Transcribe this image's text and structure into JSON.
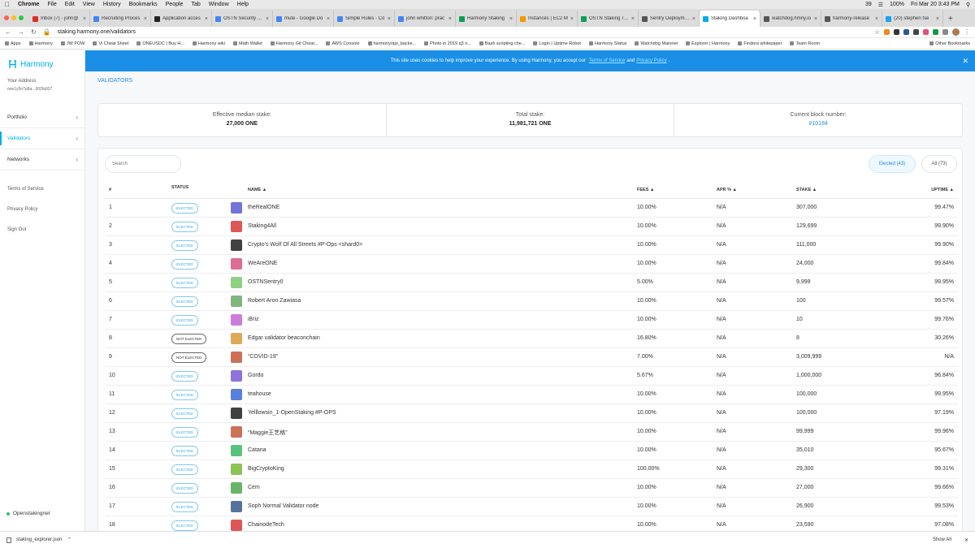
{
  "mac_menu": {
    "items": [
      "Chrome",
      "File",
      "Edit",
      "View",
      "History",
      "Bookmarks",
      "People",
      "Tab",
      "Window",
      "Help"
    ],
    "status": {
      "count": "39",
      "battery": "100%",
      "datetime": "Fri Mar 20  3:43 PM"
    }
  },
  "tabs": [
    {
      "label": "Inbox (7) - john@",
      "color": "#d93025"
    },
    {
      "label": "Recruiting Proces",
      "color": "#4285f4"
    },
    {
      "label": "Application acces",
      "color": "#222222"
    },
    {
      "label": "OSTN Security Iss",
      "color": "#4285f4"
    },
    {
      "label": "mute - Google Do",
      "color": "#4285f4"
    },
    {
      "label": "Simple Rules - Co",
      "color": "#4285f4"
    },
    {
      "label": "john whitton: prac",
      "color": "#4285f4"
    },
    {
      "label": "Harmony Staking",
      "color": "#0f9d58"
    },
    {
      "label": "Instances | EC2 M",
      "color": "#f29900"
    },
    {
      "label": "OSTN Staking Tes",
      "color": "#0f9d58"
    },
    {
      "label": "Sentry Deploymen",
      "color": "#555555"
    },
    {
      "label": "Staking Dashboa",
      "color": "#00aee9",
      "active": true
    },
    {
      "label": "watchdog.hmny.io",
      "color": "#555555"
    },
    {
      "label": "harmony-release",
      "color": "#555555"
    },
    {
      "label": "(20) stephen tse",
      "color": "#1da1f2"
    }
  ],
  "address_bar": {
    "url": "staking.harmony.one/validators"
  },
  "bookmarks": [
    "Apps",
    "Harmony",
    "JW POW",
    "Vi Cheat Sheet",
    "ONEUSDC | Buy H...",
    "Harmony wiki",
    "Math Wallet",
    "Harmony Git Cheat...",
    "AWS Console",
    "harmony/api_backe...",
    "Photo in 2019 q3 o...",
    "Bash scripting che...",
    "Login | Uptime Robot",
    "Harmony Status",
    "Watchdog Mainnet",
    "Explorer | Harmony",
    "Findora whitepaper",
    "Team Room"
  ],
  "bookmarks_other": "Other Bookmarks",
  "sidebar": {
    "brand": "Harmony",
    "address_label": "Your Address",
    "address_value": "one1y5n7p8a...002fa927",
    "nav": [
      {
        "label": "Portfolio",
        "active": false
      },
      {
        "label": "Validators",
        "active": true
      },
      {
        "label": "Networks",
        "active": false
      }
    ],
    "links": [
      "Terms of Service",
      "Privacy Policy",
      "Sign Out"
    ],
    "network": "Openstakingnet"
  },
  "cookie": {
    "text": "This site uses cookies to help improve your experience. By using Harmony, you accept our",
    "tos": "Terms of Service",
    "and": "and",
    "privacy": "Privacy Policy",
    "end": "."
  },
  "breadcrumb": "VALIDATORS",
  "stats": {
    "median_label": "Effective median stake:",
    "median_value": "27,000 ONE",
    "total_label": "Total stake:",
    "total_value": "11,981,721 ONE",
    "block_label": "Current block number:",
    "block_value": "#10184"
  },
  "filters": {
    "search_placeholder": "Search",
    "elected": "Elected (43)",
    "all": "All (73)"
  },
  "table": {
    "headers": {
      "idx": "#",
      "status": "STATUS",
      "name": "NAME ▲",
      "fees": "FEES ▲",
      "apr": "APR % ▲",
      "stake": "STAKE ▲",
      "uptime": "UPTIME ▲"
    },
    "rows": [
      {
        "idx": "1",
        "status": "ELECTED",
        "name": "theRealONE",
        "fees": "10.00%",
        "apr": "N/A",
        "stake": "307,000",
        "uptime": "99.47%",
        "logo": "#5b5bd6"
      },
      {
        "idx": "2",
        "status": "ELECTED",
        "name": "Staking4All",
        "fees": "10.00%",
        "apr": "N/A",
        "stake": "129,699",
        "uptime": "99.90%",
        "logo": "#d63b3b"
      },
      {
        "idx": "3",
        "status": "ELECTED",
        "name": "Crypto's Wolf Of All Streets #P-Ops <shard0>",
        "fees": "10.00%",
        "apr": "N/A",
        "stake": "111,000",
        "uptime": "99.90%",
        "logo": "#1e1e1e"
      },
      {
        "idx": "4",
        "status": "ELECTED",
        "name": "WeAreONE",
        "fees": "10.00%",
        "apr": "N/A",
        "stake": "24,000",
        "uptime": "99.84%",
        "logo": "#d8547e"
      },
      {
        "idx": "5",
        "status": "ELECTED",
        "name": "OSTNSentry0",
        "fees": "5.00%",
        "apr": "N/A",
        "stake": "9,999",
        "uptime": "99.95%",
        "logo": "#7bc86c"
      },
      {
        "idx": "6",
        "status": "ELECTED",
        "name": "Robert Aron Zawiasa",
        "fees": "10.00%",
        "apr": "N/A",
        "stake": "100",
        "uptime": "99.57%",
        "logo": "#6aa86a"
      },
      {
        "idx": "7",
        "status": "ELECTED",
        "name": "iBriz",
        "fees": "10.00%",
        "apr": "N/A",
        "stake": "10",
        "uptime": "99.76%",
        "logo": "#c266d6"
      },
      {
        "idx": "8",
        "status": "NOT ELECTED",
        "name": "Edgar validator beaconchain",
        "fees": "16.80%",
        "apr": "N/A",
        "stake": "8",
        "uptime": "30.26%",
        "logo": "#d69a3b"
      },
      {
        "idx": "9",
        "status": "NOT ELECTED",
        "name": "“COVID-19”",
        "fees": "7.00%",
        "apr": "N/A",
        "stake": "3,009,999",
        "uptime": "N/A",
        "logo": "#c2583b"
      },
      {
        "idx": "10",
        "status": "ELECTED",
        "name": "Gordo",
        "fees": "5.67%",
        "apr": "N/A",
        "stake": "1,000,000",
        "uptime": "96.84%",
        "logo": "#7a5bd6"
      },
      {
        "idx": "11",
        "status": "ELECTED",
        "name": "teahouse",
        "fees": "10.00%",
        "apr": "N/A",
        "stake": "100,000",
        "uptime": "99.95%",
        "logo": "#3b6ad6"
      },
      {
        "idx": "12",
        "status": "ELECTED",
        "name": "Yelllowsin_1-OpenStaking #P-OPS",
        "fees": "10.00%",
        "apr": "N/A",
        "stake": "100,000",
        "uptime": "97.19%",
        "logo": "#1e1e1e"
      },
      {
        "idx": "13",
        "status": "ELECTED",
        "name": "“Maggie王艺格”",
        "fees": "10.00%",
        "apr": "N/A",
        "stake": "99,999",
        "uptime": "99.96%",
        "logo": "#c2583b"
      },
      {
        "idx": "14",
        "status": "ELECTED",
        "name": "Catana",
        "fees": "10.00%",
        "apr": "N/A",
        "stake": "35,010",
        "uptime": "95.67%",
        "logo": "#3bb86a"
      },
      {
        "idx": "15",
        "status": "ELECTED",
        "name": "BigCryptoKing",
        "fees": "100.00%",
        "apr": "N/A",
        "stake": "29,300",
        "uptime": "99.31%",
        "logo": "#7ab83b"
      },
      {
        "idx": "16",
        "status": "ELECTED",
        "name": "Cem",
        "fees": "10.00%",
        "apr": "N/A",
        "stake": "27,000",
        "uptime": "99.66%",
        "logo": "#4da84d"
      },
      {
        "idx": "17",
        "status": "ELECTED",
        "name": "Soph Normal Validator node",
        "fees": "10.00%",
        "apr": "N/A",
        "stake": "26,900",
        "uptime": "99.53%",
        "logo": "#3b5b8a"
      },
      {
        "idx": "18",
        "status": "ELECTED",
        "name": "ChainodeTech",
        "fees": "10.00%",
        "apr": "N/A",
        "stake": "23,590",
        "uptime": "97.08%",
        "logo": "#d63b3b"
      }
    ]
  },
  "downloads": {
    "file": "staking_explorer.json",
    "show_all": "Show All"
  },
  "colors": {
    "accent": "#00aee9",
    "banner": "#1b8fe6",
    "online": "#2fbf71"
  }
}
